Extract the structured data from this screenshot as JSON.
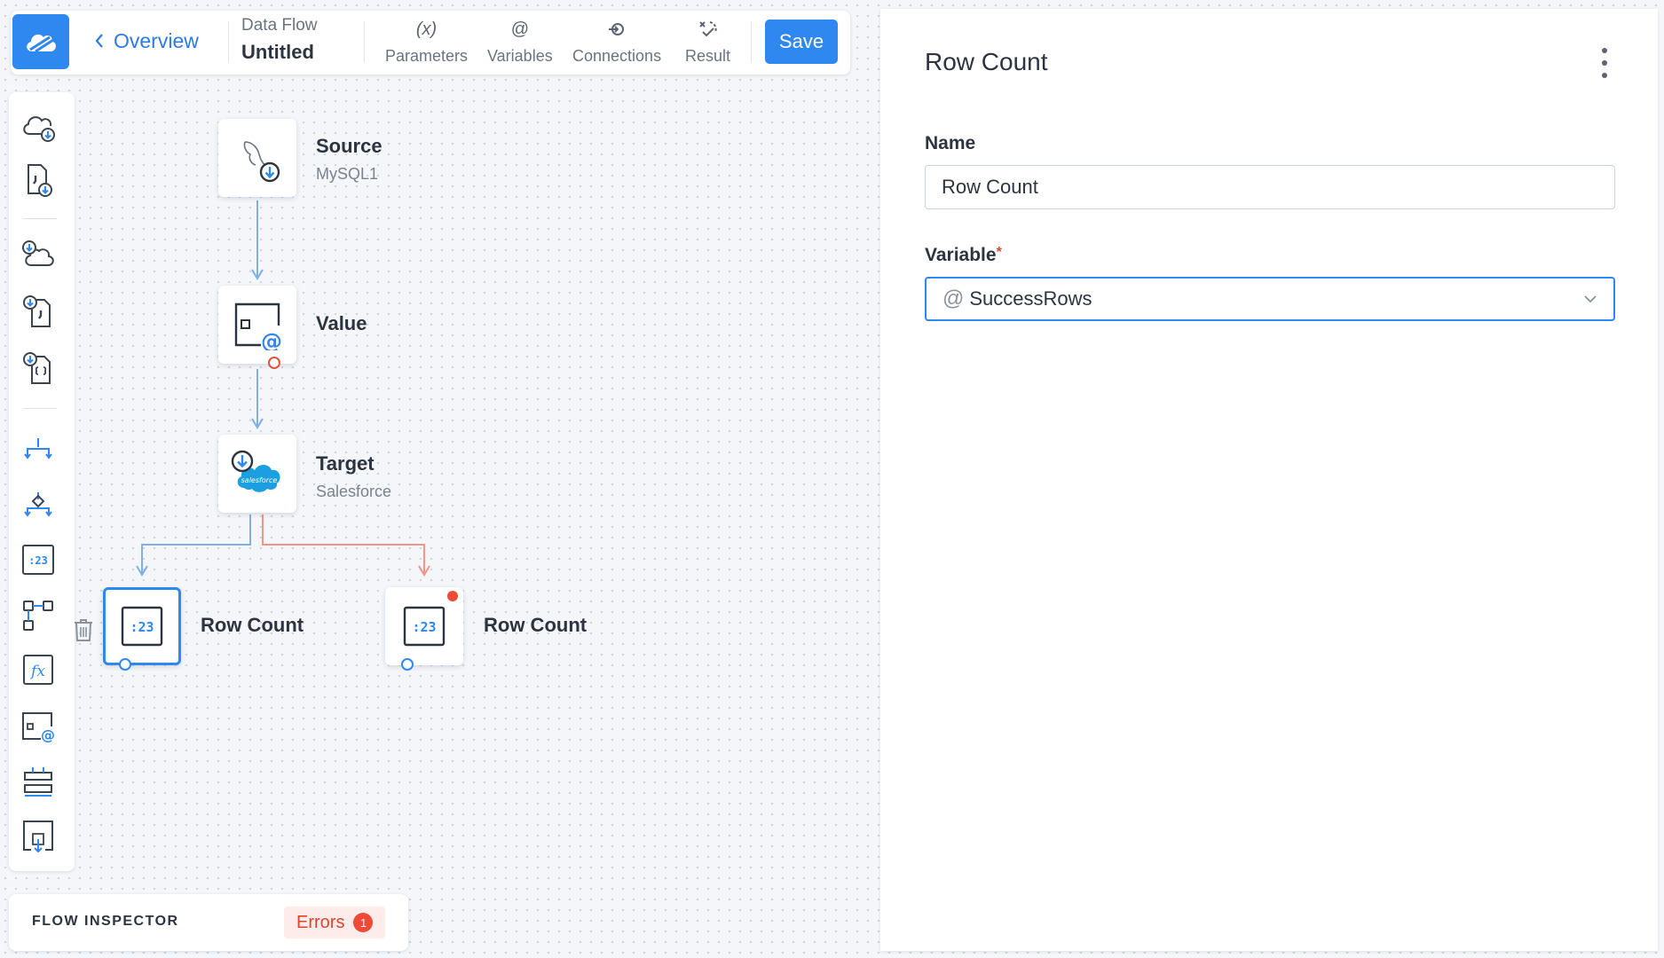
{
  "toolbar": {
    "back_label": "Overview",
    "doc_kind": "Data Flow",
    "doc_name": "Untitled",
    "buttons": [
      {
        "glyph": "(x)",
        "label": "Parameters"
      },
      {
        "glyph": "@",
        "label": "Variables"
      },
      {
        "glyph": "connections-icon",
        "label": "Connections"
      },
      {
        "glyph": "result-icon",
        "label": "Result"
      }
    ],
    "save_label": "Save"
  },
  "palette": {
    "items": [
      "cloud-source-icon",
      "file-source-icon",
      "cloud-lookup-icon",
      "file-lookup-icon",
      "json-lookup-icon",
      "conditional-split-icon",
      "merge-icon",
      "row-count-icon",
      "buffer-icon",
      "expression-icon",
      "value-icon",
      "extend-icon",
      "target-file-icon"
    ]
  },
  "canvas": {
    "nodes": {
      "source": {
        "title": "Source",
        "subtitle": "MySQL1"
      },
      "value": {
        "title": "Value"
      },
      "target": {
        "title": "Target",
        "subtitle": "Salesforce"
      },
      "row_count_1": {
        "title": "Row Count"
      },
      "row_count_2": {
        "title": "Row Count"
      }
    },
    "salesforce_logo_text": "salesforce"
  },
  "inspector": {
    "label": "FLOW INSPECTOR",
    "errors_label": "Errors",
    "errors_count": "1"
  },
  "panel": {
    "title": "Row Count",
    "name_label": "Name",
    "name_value": "Row Count",
    "variable_label": "Variable",
    "variable_required_mark": "*",
    "variable_prefix": "@",
    "variable_value": "SuccessRows"
  },
  "colors": {
    "accent": "#2f87f0",
    "error": "#ef4a36",
    "success_link": "#7fb0ea",
    "error_link": "#f0958a"
  }
}
